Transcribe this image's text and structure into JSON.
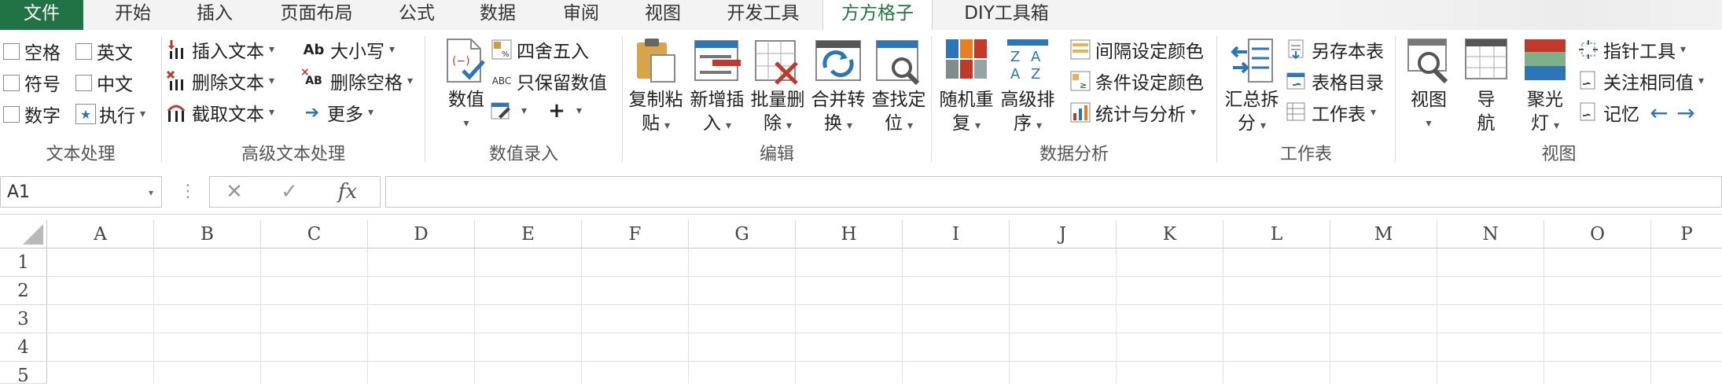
{
  "tabs": [
    "文件",
    "开始",
    "插入",
    "页面布局",
    "公式",
    "数据",
    "审阅",
    "视图",
    "开发工具",
    "方方格子",
    "DIY工具箱"
  ],
  "active_tab": "方方格子",
  "groups": {
    "text": {
      "label": "文本处理",
      "items": [
        "空格",
        "英文",
        "符号",
        "中文",
        "数字",
        "执行"
      ]
    },
    "adv_text": {
      "label": "高级文本处理",
      "items": [
        "插入文本",
        "删除文本",
        "截取文本",
        "大小写",
        "删除空格",
        "更多"
      ]
    },
    "num": {
      "label": "数值录入",
      "big": "数值",
      "items": [
        "四舍五入",
        "只保留数值"
      ]
    },
    "edit": {
      "label": "编辑",
      "buttons": [
        {
          "l1": "复制粘",
          "l2": "贴"
        },
        {
          "l1": "新增插",
          "l2": "入"
        },
        {
          "l1": "批量删",
          "l2": "除"
        },
        {
          "l1": "合并转",
          "l2": "换"
        },
        {
          "l1": "查找定",
          "l2": "位"
        }
      ]
    },
    "analysis": {
      "label": "数据分析",
      "buttons": [
        {
          "l1": "随机重",
          "l2": "复"
        },
        {
          "l1": "高级排",
          "l2": "序"
        }
      ],
      "items": [
        "间隔设定颜色",
        "条件设定颜色",
        "统计与分析"
      ]
    },
    "sheet": {
      "label": "工作表",
      "big": {
        "l1": "汇总拆",
        "l2": "分"
      },
      "items": [
        "另存本表",
        "表格目录",
        "工作表"
      ]
    },
    "view": {
      "label": "视图",
      "buttons": [
        {
          "l1": "视图",
          "l2": ""
        },
        {
          "l1": "导",
          "l2": "航"
        },
        {
          "l1": "聚光",
          "l2": "灯"
        }
      ],
      "items": [
        "指针工具",
        "关注相同值",
        "记忆"
      ]
    }
  },
  "formula_bar": {
    "name_box": "A1",
    "fx": "fx"
  },
  "columns": [
    "A",
    "B",
    "C",
    "D",
    "E",
    "F",
    "G",
    "H",
    "I",
    "J",
    "K",
    "L",
    "M",
    "N",
    "O",
    "P"
  ],
  "rows": [
    "1",
    "2",
    "3",
    "4",
    "5"
  ],
  "colors": {
    "excel_green": "#217346",
    "accent_blue": "#2e75b6",
    "accent_red": "#c0392b"
  }
}
